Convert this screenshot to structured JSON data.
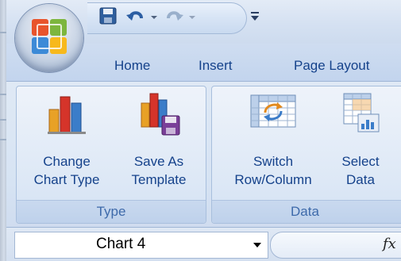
{
  "tabs": [
    {
      "label": "Home"
    },
    {
      "label": "Insert"
    },
    {
      "label": "Page Layout"
    }
  ],
  "groups": {
    "type": {
      "label": "Type",
      "buttons": [
        {
          "line1": "Change",
          "line2": "Chart Type",
          "icon": "bar-chart-icon"
        },
        {
          "line1": "Save As",
          "line2": "Template",
          "icon": "chart-save-icon"
        }
      ]
    },
    "data": {
      "label": "Data",
      "buttons": [
        {
          "line1": "Switch",
          "line2": "Row/Column",
          "icon": "switch-row-column-icon"
        },
        {
          "line1": "Select",
          "line2": "Data",
          "icon": "select-data-icon"
        }
      ]
    }
  },
  "name_box": {
    "value": "Chart 4"
  },
  "formula_bar": {
    "fx_label": "fx"
  },
  "colors": {
    "tab_text": "#15428b",
    "group_label": "#3e6aaa",
    "ribbon_bg": "#dfe9f5"
  }
}
